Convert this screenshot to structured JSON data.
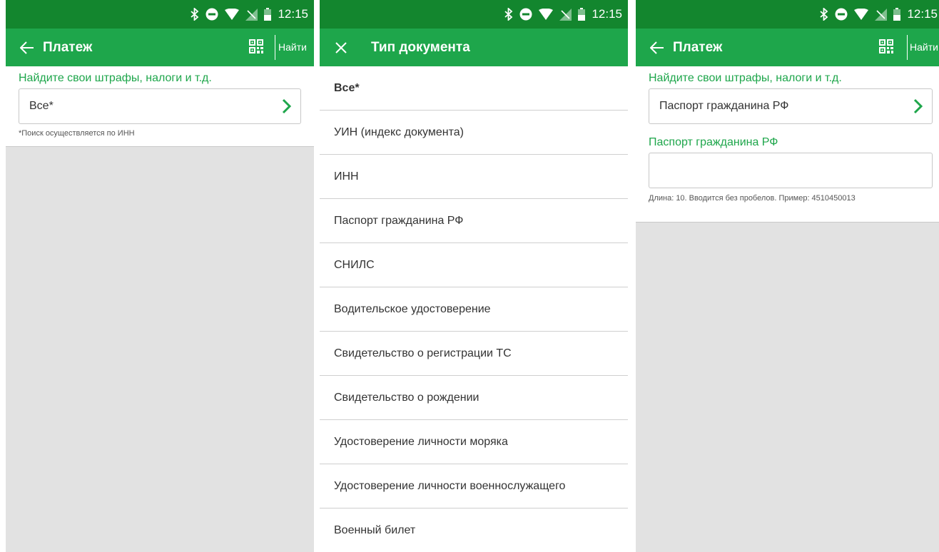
{
  "status": {
    "time": "12:15"
  },
  "screen1": {
    "title": "Платеж",
    "find_label": "Найти",
    "section_label": "Найдите свои штрафы, налоги и т.д.",
    "doc_type_value": "Все*",
    "hint": "*Поиск осуществляется по ИНН"
  },
  "screen2": {
    "title": "Тип документа",
    "items": [
      "Все*",
      "УИН (индекс документа)",
      "ИНН",
      "Паспорт гражданина РФ",
      "СНИЛС",
      "Водительское удостоверение",
      "Свидетельство о регистрации ТС",
      "Свидетельство о рождении",
      "Удостоверение личности моряка",
      "Удостоверение личности военнослужащего",
      "Военный билет"
    ]
  },
  "screen3": {
    "title": "Платеж",
    "find_label": "Найти",
    "section_label": "Найдите свои штрафы, налоги и т.д.",
    "doc_type_value": "Паспорт гражданина РФ",
    "input_label": "Паспорт гражданина РФ",
    "input_value": "",
    "input_hint": "Длина: 10. Вводится без пробелов. Пример: 4510450013"
  },
  "colors": {
    "status_bar": "#13862e",
    "app_bar": "#1ea64b",
    "accent": "#1ea64b",
    "background": "#e2e2e2"
  },
  "icons": [
    "bluetooth-icon",
    "do-not-disturb-icon",
    "wifi-icon",
    "no-signal-icon",
    "battery-icon",
    "back-arrow-icon",
    "close-icon",
    "qr-code-icon",
    "chevron-right-icon"
  ]
}
